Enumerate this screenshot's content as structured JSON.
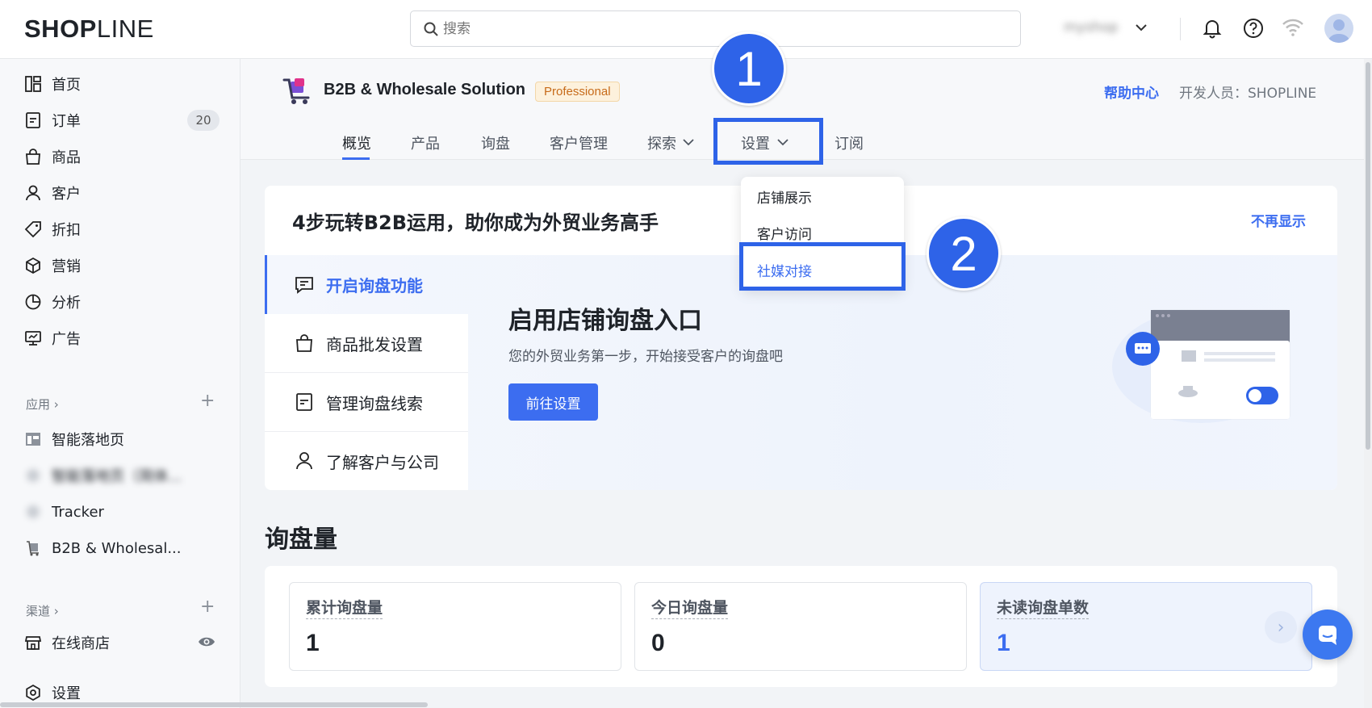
{
  "topbar": {
    "logo_bold": "SHOP",
    "logo_thin": "LINE",
    "search_placeholder": "搜索",
    "store_name": "myshop"
  },
  "sidebar": {
    "items": [
      {
        "label": "首页",
        "icon": "home-grid-icon"
      },
      {
        "label": "订单",
        "icon": "order-doc-icon",
        "badge": "20"
      },
      {
        "label": "商品",
        "icon": "shopping-bag-icon"
      },
      {
        "label": "客户",
        "icon": "user-icon"
      },
      {
        "label": "折扣",
        "icon": "tag-icon"
      },
      {
        "label": "营销",
        "icon": "cube-icon"
      },
      {
        "label": "分析",
        "icon": "pie-chart-icon"
      },
      {
        "label": "广告",
        "icon": "monitor-icon"
      }
    ],
    "apps_label": "应用 ›",
    "apps": [
      {
        "label": "智能落地页",
        "icon": "layout-icon"
      },
      {
        "label": "智能落地页（简体...",
        "icon": "app-icon"
      },
      {
        "label": "Tracker",
        "icon": "app-icon"
      },
      {
        "label": "B2B & Wholesal...",
        "icon": "cart-icon"
      }
    ],
    "channels_label": "渠道 ›",
    "channels": [
      {
        "label": "在线商店",
        "icon": "store-icon"
      }
    ],
    "settings_label": "设置"
  },
  "app_header": {
    "title": "B2B & Wholesale Solution",
    "badge": "Professional",
    "help_link": "帮助中心",
    "developer": "开发人员：SHOPLINE",
    "tabs": [
      "概览",
      "产品",
      "询盘",
      "客户管理",
      "探索",
      "设置",
      "订阅"
    ]
  },
  "settings_menu": {
    "items": [
      "店铺展示",
      "客户访问",
      "社媒对接"
    ],
    "selected": "社媒对接"
  },
  "annotations": {
    "step1": "1",
    "step2": "2"
  },
  "guide": {
    "title": "4步玩转B2B运用，助你成为外贸业务高手",
    "dismiss": "不再显示",
    "steps": [
      "开启询盘功能",
      "商品批发设置",
      "管理询盘线索",
      "了解客户与公司"
    ],
    "content_title": "启用店铺询盘入口",
    "content_desc": "您的外贸业务第一步，开始接受客户的询盘吧",
    "button": "前往设置"
  },
  "stats": {
    "title": "询盘量",
    "cards": [
      {
        "label": "累计询盘量",
        "value": "1"
      },
      {
        "label": "今日询盘量",
        "value": "0"
      },
      {
        "label": "未读询盘单数",
        "value": "1"
      }
    ]
  },
  "colors": {
    "accent": "#3c6df0",
    "highlight_border": "#2e63e8"
  }
}
